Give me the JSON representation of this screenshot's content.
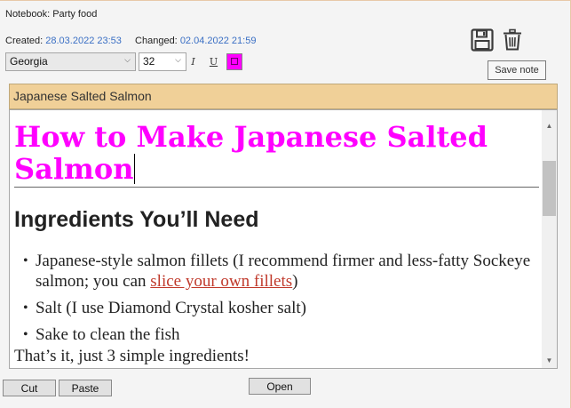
{
  "notebook": {
    "label": "Notebook: Party food"
  },
  "meta": {
    "created_label": "Created:",
    "created_value": "28.03.2022 23:53",
    "changed_label": "Changed:",
    "changed_value": "02.04.2022 21:59"
  },
  "toolbar": {
    "font": "Georgia",
    "size": "32",
    "italic": "I",
    "underline": "U",
    "color": "#ff00ff",
    "save_tooltip": "Save note",
    "icons": [
      "save-icon",
      "trash-icon"
    ]
  },
  "note": {
    "title": "Japanese Salted Salmon",
    "heading": "How to Make Japanese Salted Salmon",
    "subheading": "Ingredients You’ll Need",
    "ingredients": [
      {
        "before": "Japanese-style salmon fillets (I recommend firmer and less-fatty Sockeye salmon; you can ",
        "link": "slice your own fillets",
        "after": ")"
      },
      {
        "text": "Salt (I use Diamond Crystal kosher salt)"
      },
      {
        "text": "Sake to clean the fish"
      }
    ],
    "closing": "That’s it, just 3 simple ingredients!"
  },
  "buttons": {
    "cut": "Cut",
    "paste": "Paste",
    "open": "Open"
  }
}
